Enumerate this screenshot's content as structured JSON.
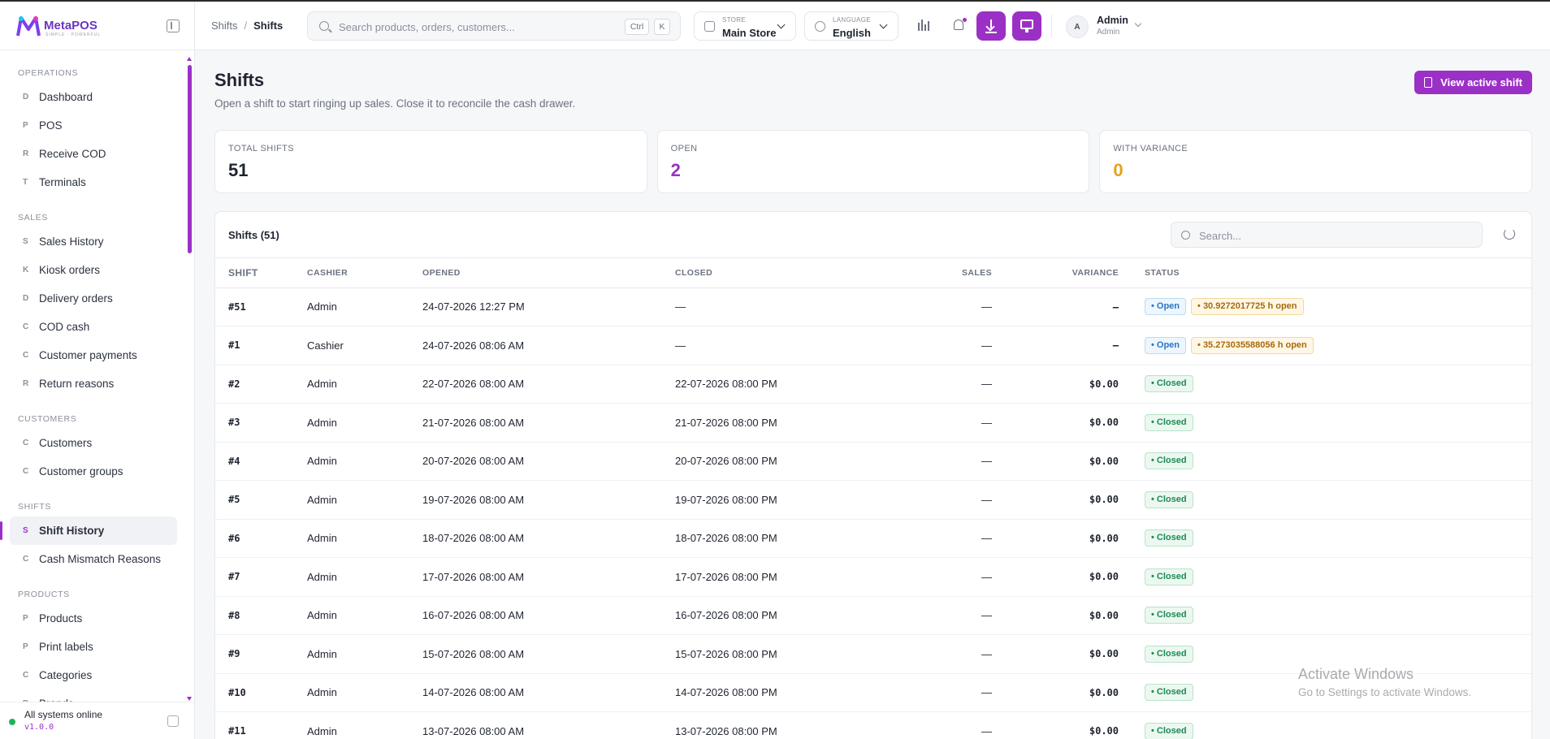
{
  "brand": {
    "name": "MetaPOS",
    "tagline": "SIMPLE · POWERFUL"
  },
  "sidebar": {
    "sections": [
      {
        "label": "OPERATIONS",
        "items": [
          {
            "letter": "D",
            "label": "Dashboard"
          },
          {
            "letter": "P",
            "label": "POS"
          },
          {
            "letter": "R",
            "label": "Receive COD"
          },
          {
            "letter": "T",
            "label": "Terminals"
          }
        ]
      },
      {
        "label": "SALES",
        "items": [
          {
            "letter": "S",
            "label": "Sales History"
          },
          {
            "letter": "K",
            "label": "Kiosk orders"
          },
          {
            "letter": "D",
            "label": "Delivery orders"
          },
          {
            "letter": "C",
            "label": "COD cash"
          },
          {
            "letter": "C",
            "label": "Customer payments"
          },
          {
            "letter": "R",
            "label": "Return reasons"
          }
        ]
      },
      {
        "label": "CUSTOMERS",
        "items": [
          {
            "letter": "C",
            "label": "Customers"
          },
          {
            "letter": "C",
            "label": "Customer groups"
          }
        ]
      },
      {
        "label": "SHIFTS",
        "items": [
          {
            "letter": "S",
            "label": "Shift History",
            "active": true
          },
          {
            "letter": "C",
            "label": "Cash Mismatch Reasons"
          }
        ]
      },
      {
        "label": "PRODUCTS",
        "items": [
          {
            "letter": "P",
            "label": "Products"
          },
          {
            "letter": "P",
            "label": "Print labels"
          },
          {
            "letter": "C",
            "label": "Categories"
          },
          {
            "letter": "B",
            "label": "Brands"
          }
        ]
      }
    ],
    "footer": {
      "status": "All systems online",
      "version": "v1.0.0"
    }
  },
  "header": {
    "breadcrumb": {
      "parent": "Shifts",
      "sep": "/",
      "current": "Shifts"
    },
    "search": {
      "placeholder": "Search products, orders, customers...",
      "kbd_ctrl": "Ctrl",
      "kbd_k": "K"
    },
    "store": {
      "label": "STORE",
      "value": "Main Store"
    },
    "language": {
      "label": "LANGUAGE",
      "value": "English"
    },
    "user": {
      "initial": "A",
      "name": "Admin",
      "role": "Admin"
    }
  },
  "page": {
    "title": "Shifts",
    "subtitle": "Open a shift to start ringing up sales. Close it to reconcile the cash drawer.",
    "action_label": "View active shift",
    "stats": [
      {
        "label": "TOTAL SHIFTS",
        "value": "51",
        "tone": "dark"
      },
      {
        "label": "OPEN",
        "value": "2",
        "tone": "purple"
      },
      {
        "label": "WITH VARIANCE",
        "value": "0",
        "tone": "amber"
      }
    ]
  },
  "table": {
    "title": "Shifts (51)",
    "search_placeholder": "Search...",
    "columns": [
      "SHIFT",
      "CASHIER",
      "OPENED",
      "CLOSED",
      "SALES",
      "VARIANCE",
      "STATUS"
    ],
    "rows": [
      {
        "shift": "#51",
        "cashier": "Admin",
        "opened": "24-07-2026 12:27 PM",
        "closed": "—",
        "sales": "—",
        "variance": "—",
        "status": "• Open",
        "hours": "• 30.9272017725 h open"
      },
      {
        "shift": "#1",
        "cashier": "Cashier",
        "opened": "24-07-2026 08:06 AM",
        "closed": "—",
        "sales": "—",
        "variance": "—",
        "status": "• Open",
        "hours": "• 35.273035588056 h open"
      },
      {
        "shift": "#2",
        "cashier": "Admin",
        "opened": "22-07-2026 08:00 AM",
        "closed": "22-07-2026 08:00 PM",
        "sales": "—",
        "variance": "$0.00",
        "status": "• Closed"
      },
      {
        "shift": "#3",
        "cashier": "Admin",
        "opened": "21-07-2026 08:00 AM",
        "closed": "21-07-2026 08:00 PM",
        "sales": "—",
        "variance": "$0.00",
        "status": "• Closed"
      },
      {
        "shift": "#4",
        "cashier": "Admin",
        "opened": "20-07-2026 08:00 AM",
        "closed": "20-07-2026 08:00 PM",
        "sales": "—",
        "variance": "$0.00",
        "status": "• Closed"
      },
      {
        "shift": "#5",
        "cashier": "Admin",
        "opened": "19-07-2026 08:00 AM",
        "closed": "19-07-2026 08:00 PM",
        "sales": "—",
        "variance": "$0.00",
        "status": "• Closed"
      },
      {
        "shift": "#6",
        "cashier": "Admin",
        "opened": "18-07-2026 08:00 AM",
        "closed": "18-07-2026 08:00 PM",
        "sales": "—",
        "variance": "$0.00",
        "status": "• Closed"
      },
      {
        "shift": "#7",
        "cashier": "Admin",
        "opened": "17-07-2026 08:00 AM",
        "closed": "17-07-2026 08:00 PM",
        "sales": "—",
        "variance": "$0.00",
        "status": "• Closed"
      },
      {
        "shift": "#8",
        "cashier": "Admin",
        "opened": "16-07-2026 08:00 AM",
        "closed": "16-07-2026 08:00 PM",
        "sales": "—",
        "variance": "$0.00",
        "status": "• Closed"
      },
      {
        "shift": "#9",
        "cashier": "Admin",
        "opened": "15-07-2026 08:00 AM",
        "closed": "15-07-2026 08:00 PM",
        "sales": "—",
        "variance": "$0.00",
        "status": "• Closed"
      },
      {
        "shift": "#10",
        "cashier": "Admin",
        "opened": "14-07-2026 08:00 AM",
        "closed": "14-07-2026 08:00 PM",
        "sales": "—",
        "variance": "$0.00",
        "status": "• Closed"
      },
      {
        "shift": "#11",
        "cashier": "Admin",
        "opened": "13-07-2026 08:00 AM",
        "closed": "13-07-2026 08:00 PM",
        "sales": "—",
        "variance": "$0.00",
        "status": "• Closed"
      }
    ]
  },
  "watermark": {
    "line1": "Activate Windows",
    "line2": "Go to Settings to activate Windows."
  },
  "colors": {
    "accent": "#9b30c6",
    "open": "#2b76c2",
    "closed": "#1e8a55",
    "warning": "#e3a21a"
  }
}
